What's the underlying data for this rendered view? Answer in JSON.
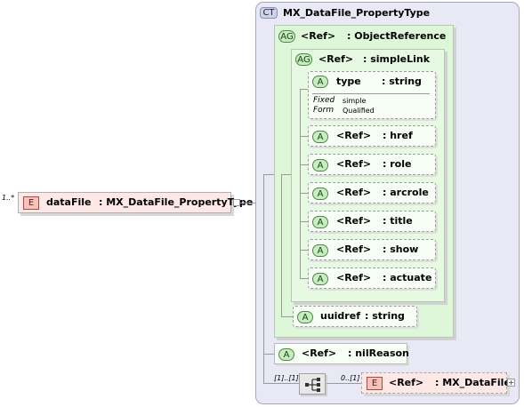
{
  "root_element": {
    "cardinality": "1..*",
    "badge": "E",
    "name": "dataFile",
    "type": ": MX_DataFile_PropertyType"
  },
  "complex_type": {
    "badge": "CT",
    "name": "MX_DataFile_PropertyType"
  },
  "object_reference_group": {
    "badge": "AG",
    "ref": "<Ref>",
    "type": ": ObjectReference"
  },
  "simple_link_group": {
    "badge": "AG",
    "ref": "<Ref>",
    "type": ": simpleLink"
  },
  "type_attribute": {
    "badge": "A",
    "name": "type",
    "type": ": string",
    "fixed_label": "Fixed",
    "fixed_value": "simple",
    "form_label": "Form",
    "form_value": "Qualified"
  },
  "link_attributes": [
    {
      "badge": "A",
      "ref": "<Ref>",
      "type": ": href"
    },
    {
      "badge": "A",
      "ref": "<Ref>",
      "type": ": role"
    },
    {
      "badge": "A",
      "ref": "<Ref>",
      "type": ": arcrole"
    },
    {
      "badge": "A",
      "ref": "<Ref>",
      "type": ": title"
    },
    {
      "badge": "A",
      "ref": "<Ref>",
      "type": ": show"
    },
    {
      "badge": "A",
      "ref": "<Ref>",
      "type": ": actuate"
    }
  ],
  "uuidref_attribute": {
    "badge": "A",
    "name": "uuidref",
    "type": ": string"
  },
  "nil_reason_attribute": {
    "badge": "A",
    "ref": "<Ref>",
    "type": ": nilReason"
  },
  "sequence": {
    "cardinality": "[1]..[1]"
  },
  "child_element": {
    "cardinality": "0..[1]",
    "badge": "E",
    "ref": "<Ref>",
    "type": ": MX_DataFile"
  }
}
